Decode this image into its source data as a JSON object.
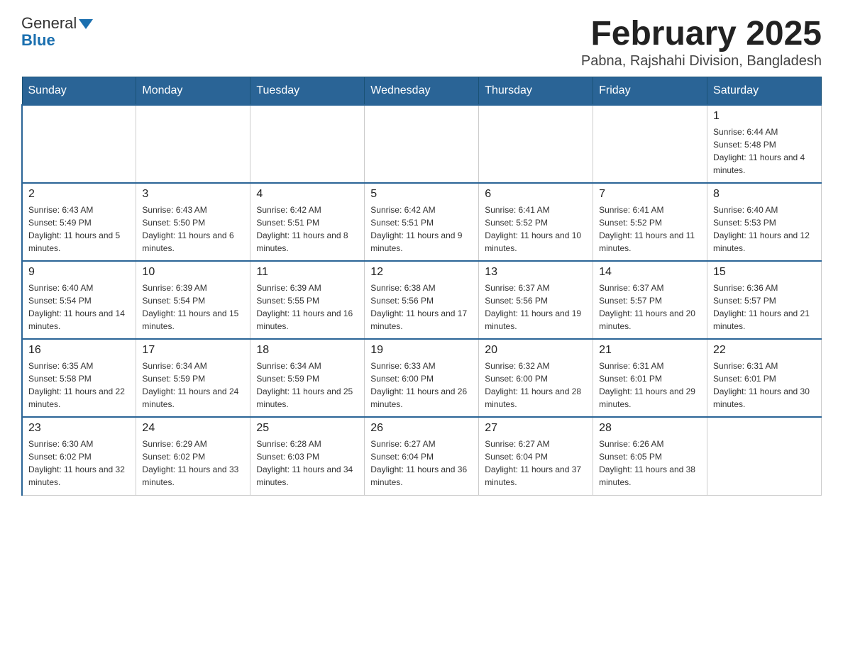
{
  "logo": {
    "text_general": "General",
    "text_blue": "Blue"
  },
  "header": {
    "title": "February 2025",
    "subtitle": "Pabna, Rajshahi Division, Bangladesh"
  },
  "weekdays": [
    "Sunday",
    "Monday",
    "Tuesday",
    "Wednesday",
    "Thursday",
    "Friday",
    "Saturday"
  ],
  "weeks": [
    [
      {
        "day": "",
        "info": ""
      },
      {
        "day": "",
        "info": ""
      },
      {
        "day": "",
        "info": ""
      },
      {
        "day": "",
        "info": ""
      },
      {
        "day": "",
        "info": ""
      },
      {
        "day": "",
        "info": ""
      },
      {
        "day": "1",
        "info": "Sunrise: 6:44 AM\nSunset: 5:48 PM\nDaylight: 11 hours and 4 minutes."
      }
    ],
    [
      {
        "day": "2",
        "info": "Sunrise: 6:43 AM\nSunset: 5:49 PM\nDaylight: 11 hours and 5 minutes."
      },
      {
        "day": "3",
        "info": "Sunrise: 6:43 AM\nSunset: 5:50 PM\nDaylight: 11 hours and 6 minutes."
      },
      {
        "day": "4",
        "info": "Sunrise: 6:42 AM\nSunset: 5:51 PM\nDaylight: 11 hours and 8 minutes."
      },
      {
        "day": "5",
        "info": "Sunrise: 6:42 AM\nSunset: 5:51 PM\nDaylight: 11 hours and 9 minutes."
      },
      {
        "day": "6",
        "info": "Sunrise: 6:41 AM\nSunset: 5:52 PM\nDaylight: 11 hours and 10 minutes."
      },
      {
        "day": "7",
        "info": "Sunrise: 6:41 AM\nSunset: 5:52 PM\nDaylight: 11 hours and 11 minutes."
      },
      {
        "day": "8",
        "info": "Sunrise: 6:40 AM\nSunset: 5:53 PM\nDaylight: 11 hours and 12 minutes."
      }
    ],
    [
      {
        "day": "9",
        "info": "Sunrise: 6:40 AM\nSunset: 5:54 PM\nDaylight: 11 hours and 14 minutes."
      },
      {
        "day": "10",
        "info": "Sunrise: 6:39 AM\nSunset: 5:54 PM\nDaylight: 11 hours and 15 minutes."
      },
      {
        "day": "11",
        "info": "Sunrise: 6:39 AM\nSunset: 5:55 PM\nDaylight: 11 hours and 16 minutes."
      },
      {
        "day": "12",
        "info": "Sunrise: 6:38 AM\nSunset: 5:56 PM\nDaylight: 11 hours and 17 minutes."
      },
      {
        "day": "13",
        "info": "Sunrise: 6:37 AM\nSunset: 5:56 PM\nDaylight: 11 hours and 19 minutes."
      },
      {
        "day": "14",
        "info": "Sunrise: 6:37 AM\nSunset: 5:57 PM\nDaylight: 11 hours and 20 minutes."
      },
      {
        "day": "15",
        "info": "Sunrise: 6:36 AM\nSunset: 5:57 PM\nDaylight: 11 hours and 21 minutes."
      }
    ],
    [
      {
        "day": "16",
        "info": "Sunrise: 6:35 AM\nSunset: 5:58 PM\nDaylight: 11 hours and 22 minutes."
      },
      {
        "day": "17",
        "info": "Sunrise: 6:34 AM\nSunset: 5:59 PM\nDaylight: 11 hours and 24 minutes."
      },
      {
        "day": "18",
        "info": "Sunrise: 6:34 AM\nSunset: 5:59 PM\nDaylight: 11 hours and 25 minutes."
      },
      {
        "day": "19",
        "info": "Sunrise: 6:33 AM\nSunset: 6:00 PM\nDaylight: 11 hours and 26 minutes."
      },
      {
        "day": "20",
        "info": "Sunrise: 6:32 AM\nSunset: 6:00 PM\nDaylight: 11 hours and 28 minutes."
      },
      {
        "day": "21",
        "info": "Sunrise: 6:31 AM\nSunset: 6:01 PM\nDaylight: 11 hours and 29 minutes."
      },
      {
        "day": "22",
        "info": "Sunrise: 6:31 AM\nSunset: 6:01 PM\nDaylight: 11 hours and 30 minutes."
      }
    ],
    [
      {
        "day": "23",
        "info": "Sunrise: 6:30 AM\nSunset: 6:02 PM\nDaylight: 11 hours and 32 minutes."
      },
      {
        "day": "24",
        "info": "Sunrise: 6:29 AM\nSunset: 6:02 PM\nDaylight: 11 hours and 33 minutes."
      },
      {
        "day": "25",
        "info": "Sunrise: 6:28 AM\nSunset: 6:03 PM\nDaylight: 11 hours and 34 minutes."
      },
      {
        "day": "26",
        "info": "Sunrise: 6:27 AM\nSunset: 6:04 PM\nDaylight: 11 hours and 36 minutes."
      },
      {
        "day": "27",
        "info": "Sunrise: 6:27 AM\nSunset: 6:04 PM\nDaylight: 11 hours and 37 minutes."
      },
      {
        "day": "28",
        "info": "Sunrise: 6:26 AM\nSunset: 6:05 PM\nDaylight: 11 hours and 38 minutes."
      },
      {
        "day": "",
        "info": ""
      }
    ]
  ],
  "colors": {
    "header_bg": "#2a6496",
    "header_text": "#ffffff",
    "border": "#aaaaaa"
  }
}
